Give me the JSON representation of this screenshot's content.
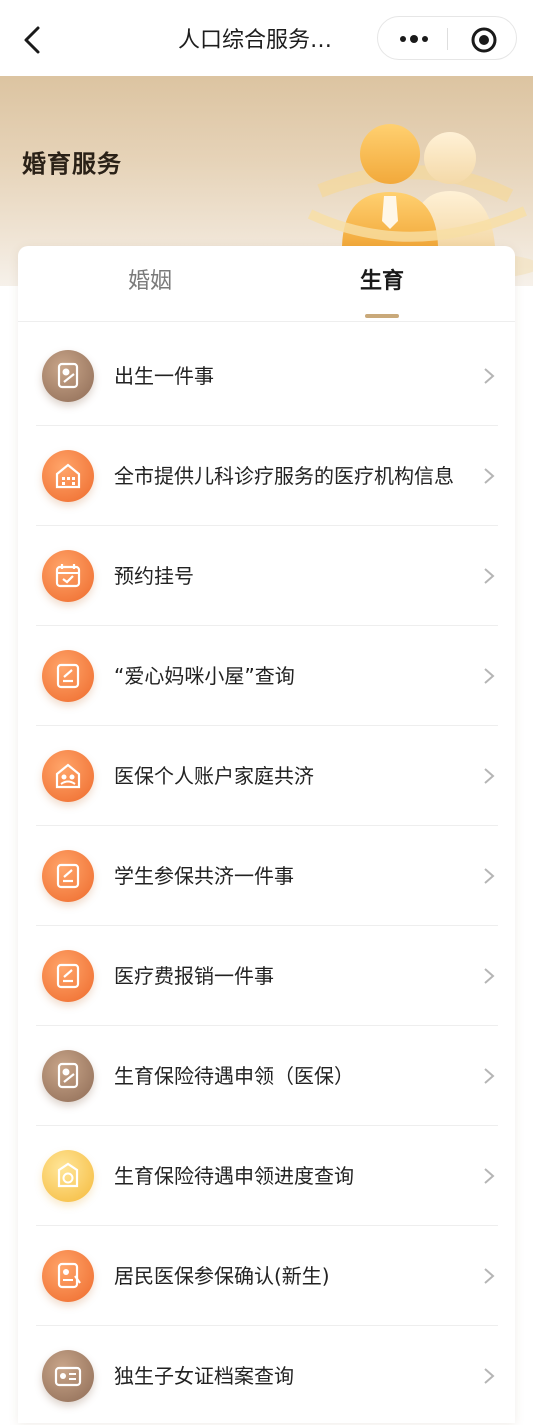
{
  "nav": {
    "title": "人口综合服务…"
  },
  "hero": {
    "title": "婚育服务"
  },
  "tabs": [
    {
      "label": "婚姻",
      "active": false
    },
    {
      "label": "生育",
      "active": true
    }
  ],
  "items": [
    {
      "label": "出生一件事",
      "icon": "certificate-icon",
      "color": "brown"
    },
    {
      "label": "全市提供儿科诊疗服务的医疗机构信息",
      "icon": "hospital-icon",
      "color": "orange"
    },
    {
      "label": "预约挂号",
      "icon": "calendar-check-icon",
      "color": "orange"
    },
    {
      "label": "“爱心妈咪小屋”查询",
      "icon": "edit-icon",
      "color": "orange"
    },
    {
      "label": "医保个人账户家庭共济",
      "icon": "family-home-icon",
      "color": "orange"
    },
    {
      "label": "学生参保共济一件事",
      "icon": "edit-icon",
      "color": "orange"
    },
    {
      "label": "医疗费报销一件事",
      "icon": "edit-icon",
      "color": "orange"
    },
    {
      "label": "生育保险待遇申领（医保）",
      "icon": "certificate-icon",
      "color": "brown"
    },
    {
      "label": "生育保险待遇申领进度查询",
      "icon": "progress-search-icon",
      "color": "yellow"
    },
    {
      "label": "居民医保参保确认(新生)",
      "icon": "insurance-doc-icon",
      "color": "orange"
    },
    {
      "label": "独生子女证档案查询",
      "icon": "id-card-icon",
      "color": "brown"
    }
  ],
  "colors": {
    "accent": "#c9a97a",
    "orange": "#ee6a2c",
    "brown": "#8e6b55",
    "yellow": "#f5b93a"
  }
}
